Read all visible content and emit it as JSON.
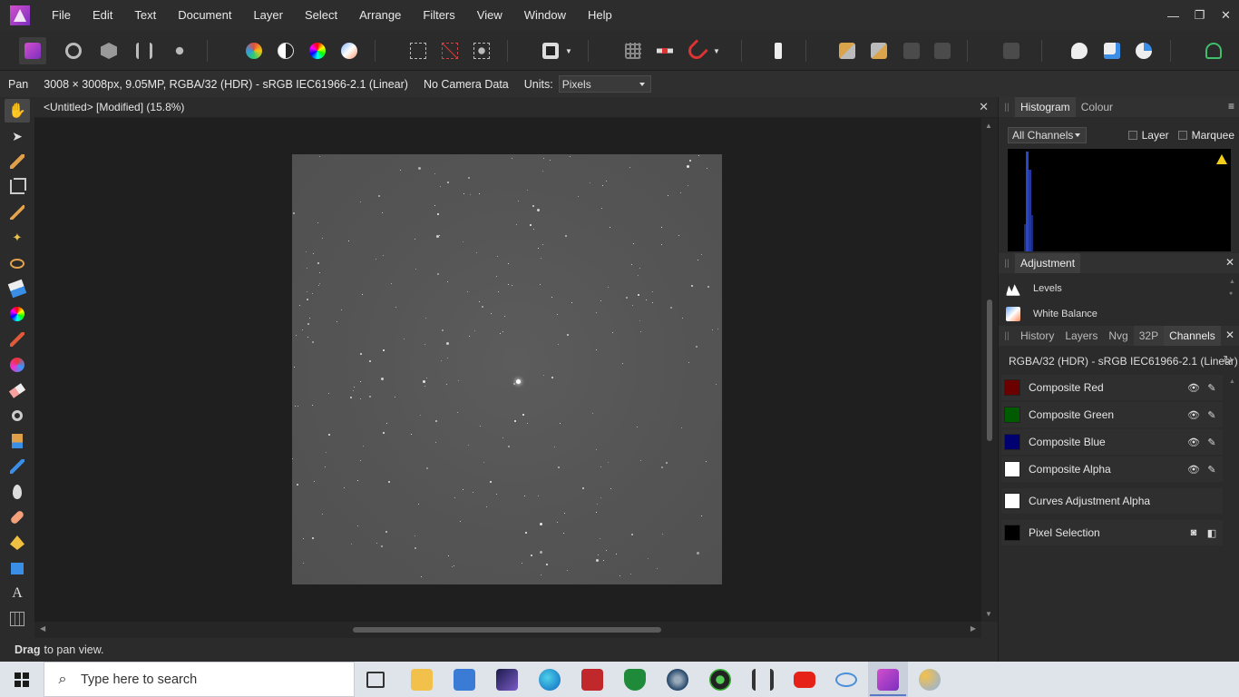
{
  "menu": [
    "File",
    "Edit",
    "Text",
    "Document",
    "Layer",
    "Select",
    "Arrange",
    "Filters",
    "View",
    "Window",
    "Help"
  ],
  "window_controls": {
    "minimize": "—",
    "restore": "❐",
    "close": "✕"
  },
  "context": {
    "tool": "Pan",
    "doc_info": "3008 × 3008px, 9.05MP, RGBA/32 (HDR) - sRGB IEC61966-2.1 (Linear)",
    "camera": "No Camera Data",
    "units_label": "Units:",
    "units_value": "Pixels"
  },
  "document": {
    "title": "<Untitled> [Modified] (15.8%)",
    "close": "✕"
  },
  "status": {
    "bold": "Drag",
    "text": "to pan view."
  },
  "histogram_panel": {
    "tabs": [
      "Histogram",
      "Colour"
    ],
    "channel_select": "All Channels",
    "layer_label": "Layer",
    "marquee_label": "Marquee"
  },
  "adjustment_panel": {
    "title": "Adjustment",
    "items": [
      "Levels",
      "White Balance"
    ]
  },
  "channels_panel": {
    "tabs": [
      "History",
      "Layers",
      "Nvg",
      "32P",
      "Channels"
    ],
    "header": "RGBA/32 (HDR) - sRGB IEC61966-2.1 (Linear)",
    "rows": [
      {
        "label": "Composite Red",
        "color": "#6b0000"
      },
      {
        "label": "Composite Green",
        "color": "#005a00"
      },
      {
        "label": "Composite Blue",
        "color": "#000070"
      },
      {
        "label": "Composite Alpha",
        "color": "#ffffff"
      }
    ],
    "extra_rows": [
      {
        "label": "Curves Adjustment Alpha",
        "color": "#ffffff"
      },
      {
        "label": "Pixel Selection",
        "color": "#000000"
      }
    ]
  },
  "taskbar": {
    "search_placeholder": "Type here to search"
  }
}
